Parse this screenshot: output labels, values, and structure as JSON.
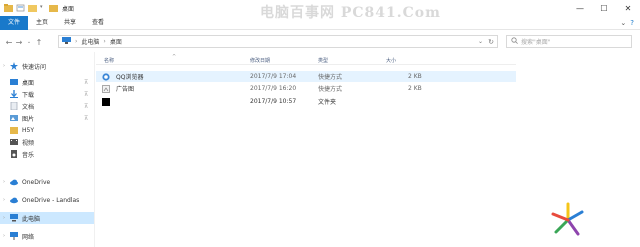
{
  "window": {
    "title": "桌面",
    "watermark": "电脑百事网 PC841.Com",
    "controls": {
      "minimize": "—",
      "maximize": "☐",
      "close": "✕"
    }
  },
  "ribbon": {
    "tabs": [
      "文件",
      "主页",
      "共享",
      "查看"
    ],
    "help_icon": "?"
  },
  "address": {
    "crumbs": [
      "此电脑",
      "桌面"
    ],
    "search_placeholder": "搜索\"桌面\""
  },
  "sidebar": {
    "items": [
      {
        "label": "快速访问",
        "icon": "star-icon",
        "color": "#2a7fd4",
        "pinned": false,
        "chevron": "›"
      },
      {
        "label": "桌面",
        "icon": "desktop-icon",
        "color": "#2a7fd4",
        "pinned": true,
        "chevron": ""
      },
      {
        "label": "下载",
        "icon": "download-icon",
        "color": "#2a7fd4",
        "pinned": true,
        "chevron": ""
      },
      {
        "label": "文档",
        "icon": "documents-icon",
        "color": "#9aa4b3",
        "pinned": true,
        "chevron": ""
      },
      {
        "label": "图片",
        "icon": "pictures-icon",
        "color": "#5a9bd6",
        "pinned": true,
        "chevron": ""
      },
      {
        "label": "H5Y",
        "icon": "folder-icon",
        "color": "#e6b84a",
        "pinned": false,
        "chevron": ""
      },
      {
        "label": "视频",
        "icon": "videos-icon",
        "color": "#555555",
        "pinned": false,
        "chevron": ""
      },
      {
        "label": "音乐",
        "icon": "music-icon",
        "color": "#555555",
        "pinned": false,
        "chevron": ""
      },
      {
        "label": "OneDrive",
        "icon": "onedrive-icon",
        "color": "#2a7fd4",
        "pinned": false,
        "chevron": "›"
      },
      {
        "label": "OneDrive - Landlas",
        "icon": "onedrive-icon",
        "color": "#2a7fd4",
        "pinned": false,
        "chevron": "›"
      },
      {
        "label": "此电脑",
        "icon": "this-pc-icon",
        "color": "#2a7fd4",
        "pinned": false,
        "chevron": "›",
        "selected": true
      },
      {
        "label": "网络",
        "icon": "network-icon",
        "color": "#2a7fd4",
        "pinned": false,
        "chevron": "›"
      }
    ]
  },
  "columns": {
    "name": "名称",
    "date": "修改日期",
    "type": "类型",
    "size": "大小",
    "sort_indicator": "^"
  },
  "files": [
    {
      "name": "QQ浏览器",
      "date": "2017/7/9 17:04",
      "type": "快捷方式",
      "size": "2 KB",
      "icon": "qq-browser-icon",
      "color": "#3a86d6",
      "hover": true
    },
    {
      "name": "广告图",
      "date": "2017/7/9 16:20",
      "type": "快捷方式",
      "size": "2 KB",
      "icon": "shortcut-image-icon",
      "color": "#888888",
      "hover": false
    },
    {
      "name": "",
      "date": "2017/7/9 10:57",
      "type": "文件夹",
      "size": "",
      "icon": "black-folder-icon",
      "color": "#000000",
      "hover": false
    }
  ],
  "logo": {
    "icon": "pinwheel-logo-icon",
    "colors": [
      "#e84b3c",
      "#f5c518",
      "#3aa657",
      "#2a7fd4",
      "#8e44ad"
    ]
  }
}
